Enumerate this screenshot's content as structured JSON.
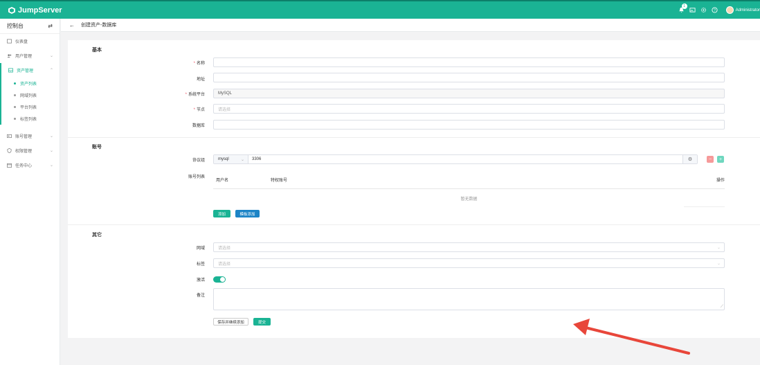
{
  "app": {
    "brand": "JumpServer"
  },
  "topbar": {
    "notification_count": "1",
    "username": "Administrator"
  },
  "sidebar": {
    "console_label": "控制台",
    "items": [
      {
        "label": "仪表盘",
        "icon": "dashboard-icon"
      },
      {
        "label": "用户管理",
        "icon": "users-icon"
      },
      {
        "label": "资产管理",
        "icon": "inbox-icon",
        "active": true,
        "children": [
          {
            "label": "资产列表",
            "active": true
          },
          {
            "label": "网域列表"
          },
          {
            "label": "平台列表"
          },
          {
            "label": "标签列表"
          }
        ]
      },
      {
        "label": "账号管理",
        "icon": "account-icon"
      },
      {
        "label": "权限管理",
        "icon": "shield-icon"
      },
      {
        "label": "任务中心",
        "icon": "calendar-icon"
      }
    ]
  },
  "header": {
    "title": "创建资产-数据库"
  },
  "form": {
    "basic": {
      "title": "基本",
      "name_label": "名称",
      "address_label": "地址",
      "platform_label": "系统平台",
      "platform_value": "MySQL",
      "node_label": "节点",
      "node_placeholder": "请选择",
      "database_label": "数据库"
    },
    "account": {
      "title": "账号",
      "protocol_label": "协议组",
      "protocol_value": "mysql",
      "port_value": "3306",
      "accounts_label": "账号列表",
      "col_username": "用户名",
      "col_privileged": "特权账号",
      "col_actions": "操作",
      "empty_text": "暂无数据",
      "add_button": "添加",
      "template_button": "模板添加"
    },
    "other": {
      "title": "其它",
      "domain_label": "网域",
      "domain_placeholder": "请选择",
      "labels_label": "标签",
      "labels_placeholder": "请选择",
      "active_label": "激活",
      "active": true,
      "comment_label": "备注"
    },
    "save_continue_button": "保存并继续添加",
    "submit_button": "提交"
  },
  "colors": {
    "primary": "#1ab394",
    "info": "#1c84c6",
    "danger": "#ed5565",
    "annotation": "#e8463a"
  }
}
